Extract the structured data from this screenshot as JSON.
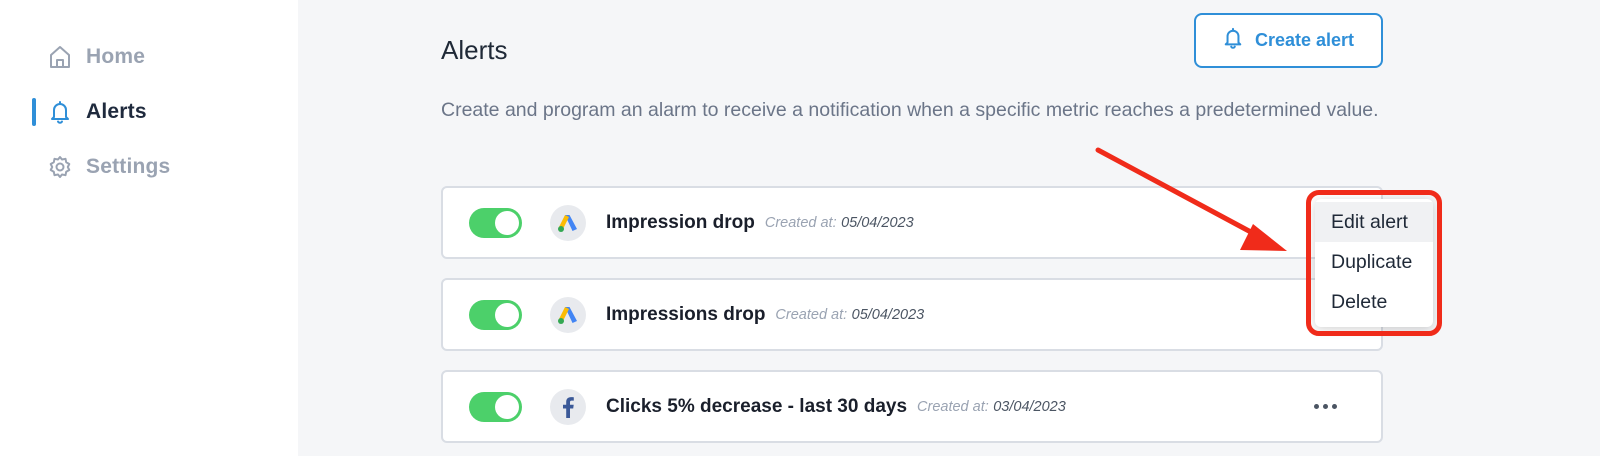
{
  "sidebar": {
    "items": [
      {
        "label": "Home",
        "icon": "home-icon",
        "active": false
      },
      {
        "label": "Alerts",
        "icon": "bell-icon",
        "active": true
      },
      {
        "label": "Settings",
        "icon": "gear-icon",
        "active": false
      }
    ]
  },
  "header": {
    "title": "Alerts",
    "create_button_label": "Create alert",
    "create_button_icon": "bell-icon"
  },
  "main": {
    "description": "Create and program an alarm to receive a notification when a specific metric reaches a predetermined value.",
    "alerts": [
      {
        "name": "Impression drop",
        "created_label": "Created at:",
        "created_date": "05/04/2023",
        "source_icon": "google-ads-icon",
        "enabled": true
      },
      {
        "name": "Impressions drop",
        "created_label": "Created at:",
        "created_date": "05/04/2023",
        "source_icon": "google-ads-icon",
        "enabled": true
      },
      {
        "name": "Clicks 5% decrease - last 30 days",
        "created_label": "Created at:",
        "created_date": "03/04/2023",
        "source_icon": "facebook-icon",
        "enabled": true
      }
    ]
  },
  "context_menu": {
    "items": [
      {
        "label": "Edit alert"
      },
      {
        "label": "Duplicate"
      },
      {
        "label": "Delete"
      }
    ]
  },
  "colors": {
    "accent": "#2f8fd8",
    "toggle_on": "#4cd06a",
    "annotation": "#f02b1a",
    "page_background": "#f5f6f8"
  }
}
